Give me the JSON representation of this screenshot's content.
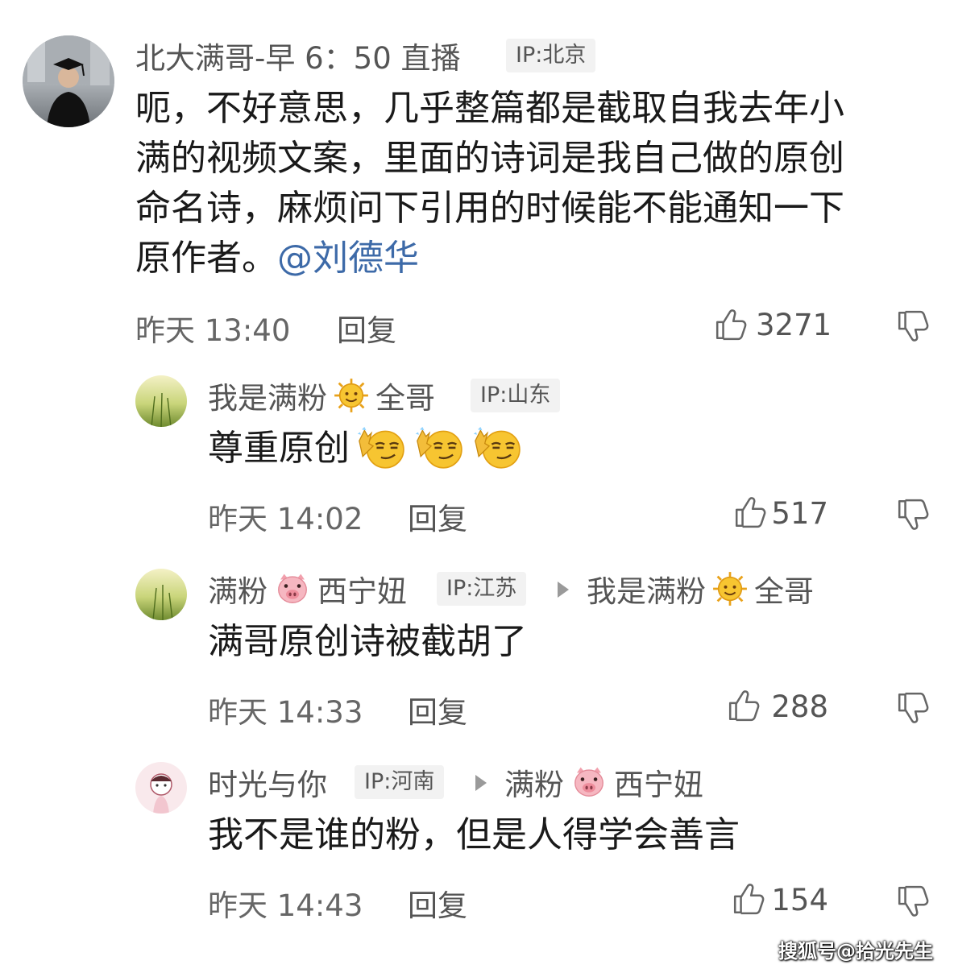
{
  "comments": [
    {
      "author": "北大满哥-早 6：50 直播",
      "ip": "IP:北京",
      "text_lines": [
        "呃，不好意思，几乎整篇都是截取自我去年小",
        "满的视频文案，里面的诗词是我自己做的原创",
        "命名诗，麻烦问下引用的时候能不能通知一下"
      ],
      "text_last": "原作者。",
      "mention": "@刘德华",
      "time": "昨天 13:40",
      "reply_label": "回复",
      "likes": "3271"
    },
    {
      "author_a": "我是满粉",
      "author_b": "全哥",
      "ip": "IP:山东",
      "text": "尊重原创",
      "time": "昨天 14:02",
      "reply_label": "回复",
      "likes": "517"
    },
    {
      "author_a": "满粉",
      "author_b": "西宁妞",
      "ip": "IP:江苏",
      "reply_to_a": "我是满粉",
      "reply_to_b": "全哥",
      "text": "满哥原创诗被截胡了",
      "time": "昨天 14:33",
      "reply_label": "回复",
      "likes": "288"
    },
    {
      "author": "时光与你",
      "ip": "IP:河南",
      "reply_to_a": "满粉",
      "reply_to_b": "西宁妞",
      "text": "我不是谁的粉，但是人得学会善言",
      "time": "昨天 14:43",
      "reply_label": "回复",
      "likes": "154"
    }
  ],
  "watermark": "搜狐号@拾光先生",
  "icons": [
    "thumbs-up-icon",
    "thumbs-down-icon",
    "sun-emoji-icon",
    "pig-emoji-icon",
    "smirk-emoji-icon",
    "reply-arrow-icon"
  ]
}
